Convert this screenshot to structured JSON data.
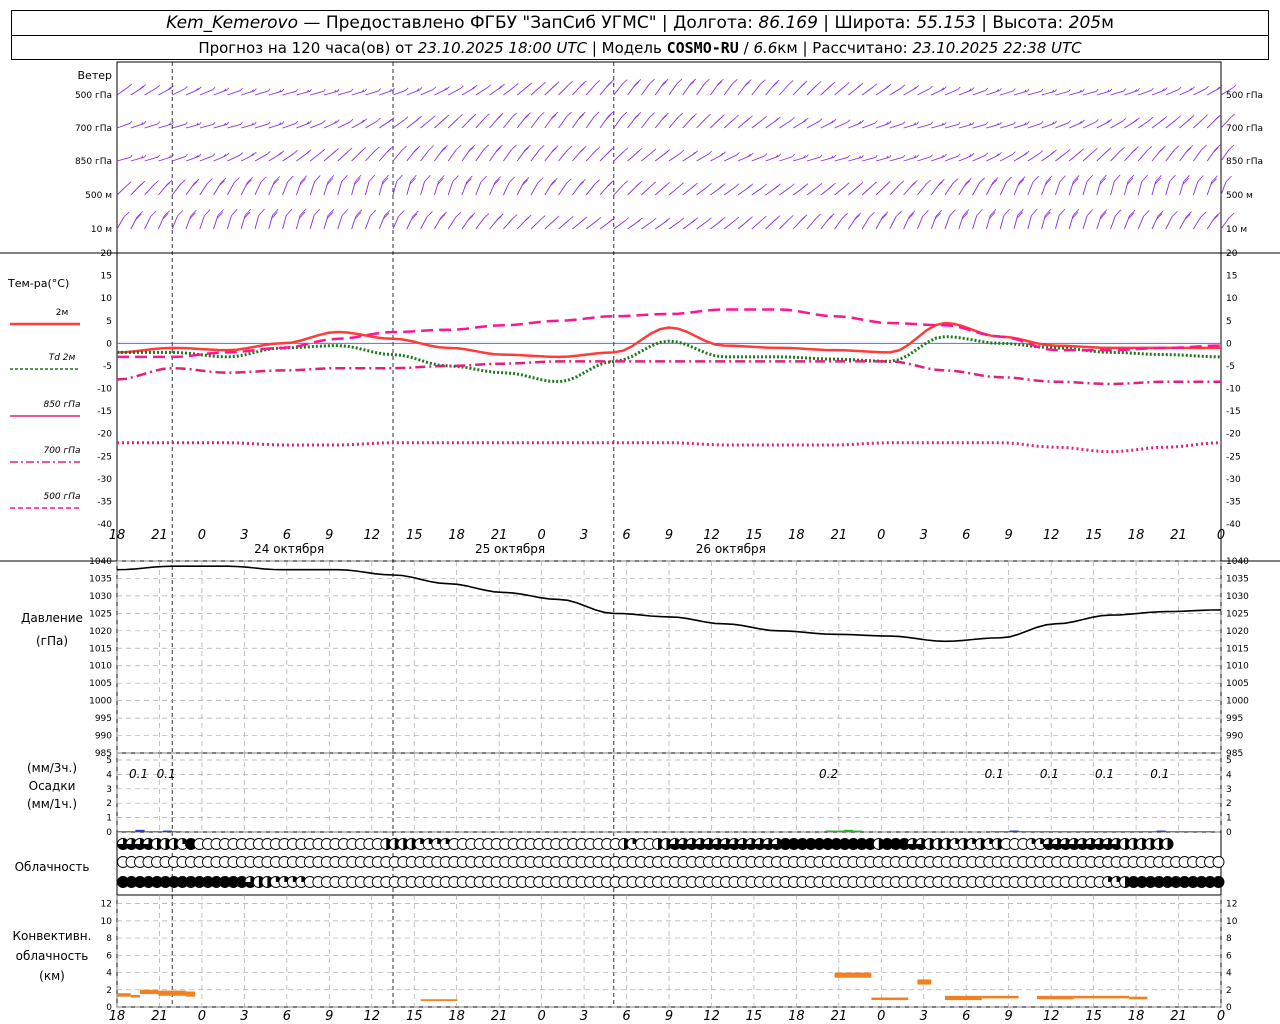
{
  "header": {
    "station": "Kem_Kemerovo",
    "provided_by": "— Предоставлено ФГБУ \"ЗапСиб УГМС\"",
    "lon_label": "Долгота:",
    "lon_value": "86.169",
    "lat_label": "Широта:",
    "lat_value": "55.153",
    "alt_label": "Высота:",
    "alt_value": "205",
    "alt_unit": "м",
    "forecast_prefix": "Прогноз на 120 часа(ов) от",
    "forecast_start": "23.10.2025 18:00 UTC",
    "model_label": "Модель",
    "model_name": "COSMO-RU",
    "model_res": "6.6",
    "model_res_unit": "км",
    "calc_label": "Рассчитано:",
    "calc_time": "23.10.2025 22:38 UTC"
  },
  "colors": {
    "wind": "#8a2be2",
    "t2m": "#ff3b3b",
    "td2m": "#1a7a1a",
    "t850": "#e0207a",
    "t700": "#e0207a",
    "t500": "#ff1493",
    "pressure": "#000000",
    "precip": "#1f3fd6",
    "precip_green": "#22b522",
    "convective": "#f08020",
    "zero_line": "#3355ff"
  },
  "time_axis": {
    "hour_labels": [
      "18",
      "21",
      "0",
      "3",
      "6",
      "9",
      "12",
      "15",
      "18",
      "21",
      "0",
      "3",
      "6",
      "9",
      "12",
      "15",
      "18",
      "21",
      "0",
      "3",
      "6",
      "9",
      "12",
      "15",
      "18",
      "21",
      "0"
    ],
    "dates": [
      "24 октября",
      "25 октября",
      "26 октября"
    ]
  },
  "wind": {
    "title": "Ветер",
    "levels": [
      "500 гПа",
      "700 гПа",
      "850 гПа",
      "500 м",
      "10   м"
    ],
    "right_levels": [
      "500 гПа",
      "700 гПа",
      "850 гПа",
      "500 м",
      "10   м"
    ]
  },
  "temperature": {
    "title": "Тем-ра(°C)",
    "legend": [
      "2м",
      "Td  2м",
      "850 гПа",
      "700 гПа",
      "500 гПа"
    ]
  },
  "pressure_panel": {
    "title_line1": "Давление",
    "title_line2": "(гПа)"
  },
  "precip_panel": {
    "label_1": "(мм/3ч.)",
    "label_2": "Осадки",
    "label_3": "(мм/1ч.)",
    "amount_labels": [
      {
        "h": 3,
        "text": "0.1"
      },
      {
        "h": 6,
        "text": "0.1"
      },
      {
        "h": 78,
        "text": "0.2"
      },
      {
        "h": 96,
        "text": "0.1"
      },
      {
        "h": 102,
        "text": "0.1"
      },
      {
        "h": 108,
        "text": "0.1"
      },
      {
        "h": 114,
        "text": "0.1"
      }
    ]
  },
  "cloud_panel": {
    "title": "Облачность"
  },
  "convective_panel": {
    "title_line1": "Конвективн.",
    "title_line2": "облачность",
    "title_line3": "(км)"
  },
  "chart_data": [
    {
      "type": "line",
      "title": "Тем-ра(°C)",
      "x_unit": "hours since 23.10.2025 18:00 UTC",
      "ylim": [
        -40,
        20
      ],
      "yticks": [
        20,
        15,
        10,
        5,
        0,
        -5,
        -10,
        -15,
        -20,
        -25,
        -30,
        -35,
        -40
      ],
      "series": [
        {
          "name": "2м",
          "style": "solid",
          "x": [
            0,
            6,
            12,
            18,
            24,
            30,
            36,
            42,
            48,
            54,
            60,
            66,
            72,
            78,
            84,
            90,
            96,
            102,
            108,
            114,
            120
          ],
          "values": [
            -2,
            -1,
            -1.5,
            0,
            2.5,
            1,
            -1,
            -2.5,
            -3,
            -2,
            3.5,
            -0.5,
            -1,
            -1.5,
            -2,
            4.5,
            1.5,
            -0.5,
            -1,
            -1,
            -1
          ]
        },
        {
          "name": "Td  2м",
          "style": "dotted",
          "x": [
            0,
            6,
            12,
            18,
            24,
            30,
            36,
            42,
            48,
            54,
            60,
            66,
            72,
            78,
            84,
            90,
            96,
            102,
            108,
            114,
            120
          ],
          "values": [
            -2,
            -2,
            -3,
            -1,
            -0.5,
            -2.5,
            -5,
            -6.5,
            -8.5,
            -4,
            0.5,
            -3,
            -3,
            -3.5,
            -4,
            1.5,
            0,
            -1,
            -2,
            -2.5,
            -3
          ]
        },
        {
          "name": "850 гПа",
          "style": "dashdot",
          "x": [
            0,
            6,
            12,
            18,
            24,
            30,
            36,
            42,
            48,
            54,
            60,
            66,
            72,
            78,
            84,
            90,
            96,
            102,
            108,
            114,
            120
          ],
          "values": [
            -8,
            -5.5,
            -6.5,
            -6,
            -5.5,
            -5.5,
            -5,
            -4.5,
            -4,
            -4,
            -4,
            -4,
            -4,
            -4,
            -4,
            -6,
            -7.5,
            -8.5,
            -9,
            -8.5,
            -8.5
          ]
        },
        {
          "name": "700 гПа",
          "style": "dotted",
          "x": [
            0,
            6,
            12,
            18,
            24,
            30,
            36,
            42,
            48,
            54,
            60,
            66,
            72,
            78,
            84,
            90,
            96,
            102,
            108,
            114,
            120
          ],
          "values": [
            -22,
            -22,
            -22,
            -22.5,
            -22.5,
            -22,
            -22,
            -22,
            -22,
            -22,
            -22,
            -22.5,
            -22.5,
            -22.5,
            -22,
            -22,
            -22,
            -23,
            -24,
            -23,
            -22
          ]
        },
        {
          "name": "500 гПа",
          "style": "dashed",
          "x": [
            0,
            6,
            12,
            18,
            24,
            30,
            36,
            42,
            48,
            54,
            60,
            66,
            72,
            78,
            84,
            90,
            96,
            102,
            108,
            114,
            120
          ],
          "values": [
            -3,
            -3,
            -2,
            -1,
            1,
            2.5,
            3,
            4,
            5,
            6,
            6.5,
            7.5,
            7.5,
            6,
            4.5,
            4,
            1.5,
            -1.5,
            -1.5,
            -1,
            -0.5
          ]
        }
      ]
    },
    {
      "type": "line",
      "title": "Давление",
      "ylabel": "(гПа)",
      "x_unit": "hours since 23.10.2025 18:00 UTC",
      "ylim": [
        985,
        1040
      ],
      "yticks": [
        1040,
        1035,
        1030,
        1025,
        1020,
        1015,
        1010,
        1005,
        1000,
        995,
        990,
        985
      ],
      "series": [
        {
          "name": "",
          "x": [
            0,
            6,
            12,
            18,
            24,
            30,
            36,
            42,
            48,
            54,
            60,
            66,
            72,
            78,
            84,
            90,
            96,
            102,
            108,
            114,
            120
          ],
          "values": [
            1037.5,
            1038.5,
            1038.5,
            1037.5,
            1037.5,
            1036,
            1033.5,
            1031,
            1029,
            1025,
            1024,
            1022,
            1020,
            1019,
            1018.5,
            1017,
            1018,
            1022,
            1024.5,
            1025.5,
            1026
          ]
        }
      ]
    },
    {
      "type": "bar",
      "title": "Осадки",
      "ylabel": "(мм/3ч.) (мм/1ч.)",
      "ylim": [
        0,
        5
      ],
      "yticks": [
        5,
        4,
        3,
        2,
        1,
        0
      ],
      "x_hours": [
        1,
        2,
        3,
        4,
        5,
        6,
        7,
        78,
        79,
        80,
        81,
        96,
        97,
        98,
        99,
        100,
        101,
        102,
        103,
        104,
        105,
        106,
        107,
        108,
        109,
        110,
        111,
        112,
        113,
        114,
        115,
        116,
        117,
        118,
        119
      ],
      "values": [
        0.05,
        0.05,
        0.15,
        0.05,
        0.05,
        0.1,
        0.05,
        0.1,
        0.1,
        0.15,
        0.1,
        0.05,
        0.05,
        0.1,
        0.05,
        0.05,
        0.05,
        0.05,
        0.05,
        0.05,
        0.05,
        0.05,
        0.05,
        0.05,
        0.05,
        0.05,
        0.05,
        0.05,
        0.05,
        0.1,
        0.05,
        0.05,
        0.05,
        0.05,
        0.05
      ]
    },
    {
      "type": "table",
      "title": "Облачность",
      "note": "cloud cover symbols per hour for 3 levels (0-4 scale, 4 = overcast)",
      "rows": [
        {
          "name": "upper",
          "x_hours_start": 0,
          "values": [
            3,
            3,
            3,
            3,
            2,
            2,
            2,
            1,
            4,
            0,
            0,
            0,
            0,
            0,
            0,
            0,
            0,
            0,
            0,
            0,
            0,
            0,
            0,
            0,
            0,
            0,
            0,
            0,
            0,
            0,
            0,
            2,
            2,
            2,
            2,
            1,
            1,
            1,
            1,
            0,
            0,
            0,
            0,
            0,
            0,
            0,
            0,
            0,
            0,
            0,
            0,
            0,
            0,
            0,
            0,
            0,
            0,
            0,
            0,
            2,
            1,
            0,
            0,
            2,
            2,
            3,
            3,
            3,
            3,
            3,
            3,
            3,
            3,
            3,
            3,
            3,
            3,
            3,
            4,
            4,
            4,
            4,
            4,
            4,
            4,
            4,
            4,
            4,
            4,
            2,
            4,
            4,
            4,
            3,
            3,
            2,
            2,
            2,
            1,
            2,
            1,
            2,
            1,
            2,
            0,
            0,
            0,
            1,
            1,
            3,
            3,
            3,
            3,
            3,
            3,
            3,
            3,
            3,
            2,
            2,
            2,
            2,
            2,
            2
          ]
        },
        {
          "name": "middle",
          "x_hours_start": 0,
          "values": [
            0,
            0,
            0,
            0,
            0,
            0,
            0,
            0,
            0,
            0,
            0,
            0,
            0,
            0,
            0,
            0,
            0,
            0,
            0,
            0,
            0,
            0,
            0,
            0,
            0,
            0,
            0,
            0,
            0,
            0,
            0,
            0,
            0,
            0,
            0,
            0,
            0,
            0,
            0,
            0,
            0,
            0,
            0,
            0,
            0,
            0,
            0,
            0,
            0,
            0,
            0,
            0,
            0,
            0,
            0,
            0,
            0,
            0,
            0,
            0,
            0,
            0,
            0,
            0,
            0,
            0,
            0,
            0,
            0,
            0,
            0,
            0,
            0,
            0,
            0,
            0,
            0,
            0,
            0,
            0,
            0,
            0,
            0,
            0,
            0,
            0,
            0,
            0,
            0,
            0,
            0,
            0,
            0,
            0,
            0,
            0,
            0,
            0,
            0,
            0,
            0,
            0,
            0,
            0,
            0,
            0,
            0,
            0,
            0,
            0,
            0,
            0,
            0,
            0,
            0,
            0,
            0,
            0,
            0,
            0,
            0,
            0,
            0,
            0,
            0,
            0,
            0,
            0,
            0,
            0,
            0,
            0,
            0,
            0,
            0,
            0,
            0,
            0,
            0,
            0,
            0,
            0,
            0,
            0,
            0,
            0,
            0,
            0,
            0,
            0,
            0,
            0,
            0,
            0,
            0,
            0,
            0,
            0,
            0,
            0,
            0,
            0,
            0,
            0,
            0,
            0,
            0,
            0,
            0,
            0,
            0,
            0,
            0,
            0,
            0,
            0,
            0,
            0,
            0,
            0,
            2,
            2,
            3,
            3,
            4,
            4,
            4,
            4,
            4,
            4,
            4,
            4,
            4,
            4,
            4,
            4,
            4,
            4,
            1,
            0,
            0,
            0,
            0,
            0,
            0,
            0,
            0,
            0,
            0,
            0,
            0,
            0,
            0,
            0,
            0,
            0,
            0,
            2,
            2
          ]
        },
        {
          "name": "lower",
          "x_hours_start": 0,
          "values": [
            4,
            4,
            4,
            4,
            4,
            4,
            4,
            4,
            4,
            4,
            4,
            4,
            4,
            4,
            4,
            3,
            2,
            2,
            1,
            1,
            1,
            1,
            0,
            0,
            0,
            0,
            0,
            0,
            0,
            0,
            0,
            0,
            0,
            0,
            0,
            0,
            0,
            0,
            0,
            0,
            0,
            0,
            0,
            0,
            0,
            0,
            0,
            0,
            0,
            0,
            0,
            0,
            0,
            0,
            0,
            0,
            0,
            0,
            0,
            0,
            0,
            0,
            0,
            0,
            0,
            0,
            0,
            0,
            0,
            0,
            0,
            0,
            0,
            0,
            0,
            0,
            0,
            0,
            0,
            0,
            0,
            0,
            0,
            0,
            0,
            0,
            0,
            0,
            0,
            0,
            0,
            0,
            0,
            0,
            0,
            0,
            0,
            0,
            0,
            0,
            0,
            0,
            0,
            0,
            0,
            0,
            0,
            0,
            0,
            0,
            0,
            0,
            0,
            0,
            0,
            0,
            1,
            1,
            2,
            4,
            4,
            4,
            4,
            4,
            4,
            4,
            4,
            4,
            4,
            4,
            4,
            4,
            4,
            4,
            4,
            4,
            4,
            4,
            4,
            4,
            4,
            4,
            4,
            4,
            4,
            4,
            4,
            4,
            4,
            4,
            4,
            4,
            4,
            4,
            4,
            4,
            4,
            4,
            4,
            4,
            4,
            4,
            4,
            4,
            4,
            4,
            4,
            4
          ]
        }
      ]
    },
    {
      "type": "bar",
      "title": "Конвективн. облачность",
      "ylabel": "(км)",
      "ylim": [
        0,
        13
      ],
      "yticks": [
        12,
        10,
        8,
        6,
        4,
        2,
        0
      ],
      "segments": [
        {
          "h_start": 0,
          "h_end": 1.5,
          "base": 1.2,
          "top": 1.6
        },
        {
          "h_start": 1.5,
          "h_end": 2.5,
          "base": 1.1,
          "top": 1.4
        },
        {
          "h_start": 2.5,
          "h_end": 4.5,
          "base": 1.5,
          "top": 2.0
        },
        {
          "h_start": 4.5,
          "h_end": 7.5,
          "base": 1.3,
          "top": 1.9
        },
        {
          "h_start": 7.5,
          "h_end": 8.5,
          "base": 1.2,
          "top": 1.8
        },
        {
          "h_start": 33,
          "h_end": 37,
          "base": 0.7,
          "top": 0.9
        },
        {
          "h_start": 78,
          "h_end": 82,
          "base": 3.4,
          "top": 4.0
        },
        {
          "h_start": 82,
          "h_end": 86,
          "base": 0.8,
          "top": 1.1
        },
        {
          "h_start": 87,
          "h_end": 88.5,
          "base": 2.6,
          "top": 3.2
        },
        {
          "h_start": 90,
          "h_end": 94,
          "base": 0.8,
          "top": 1.3
        },
        {
          "h_start": 94,
          "h_end": 98,
          "base": 1.0,
          "top": 1.3
        },
        {
          "h_start": 100,
          "h_end": 104,
          "base": 0.9,
          "top": 1.3
        },
        {
          "h_start": 104,
          "h_end": 110,
          "base": 1.0,
          "top": 1.3
        },
        {
          "h_start": 110,
          "h_end": 112,
          "base": 0.9,
          "top": 1.2
        }
      ]
    }
  ]
}
